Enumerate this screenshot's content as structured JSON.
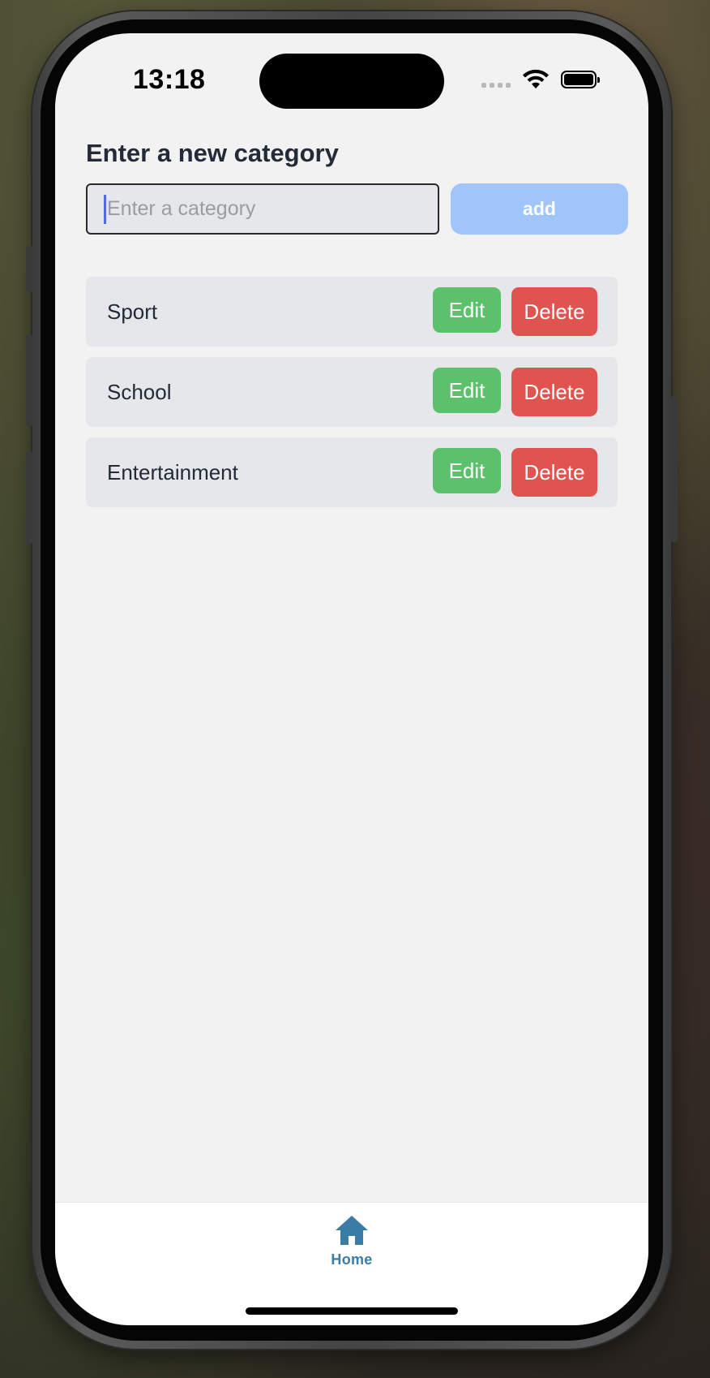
{
  "status_bar": {
    "time": "13:18"
  },
  "form": {
    "heading": "Enter a new category",
    "input_placeholder": "Enter a category",
    "input_value": "",
    "add_label": "add"
  },
  "categories": [
    {
      "name": "Sport",
      "edit_label": "Edit",
      "delete_label": "Delete"
    },
    {
      "name": "School",
      "edit_label": "Edit",
      "delete_label": "Delete"
    },
    {
      "name": "Entertainment",
      "edit_label": "Edit",
      "delete_label": "Delete"
    }
  ],
  "tab_bar": {
    "home_label": "Home",
    "home_icon": "home-icon"
  },
  "colors": {
    "edit": "#5cc16b",
    "delete": "#e05450",
    "add_disabled": "#9fc5fa",
    "tab_active": "#3a7ca5"
  }
}
